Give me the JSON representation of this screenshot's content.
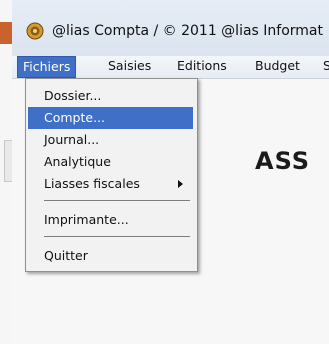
{
  "window": {
    "title": "@lias Compta  /  © 2011 @lias Informat",
    "icon": "app-icon"
  },
  "menubar": {
    "items": [
      "Fichiers",
      "Saisies",
      "Editions",
      "Budget",
      "S"
    ],
    "active": "Fichiers"
  },
  "dropdown": {
    "items": [
      {
        "label": "Dossier..."
      },
      {
        "label": "Compte...",
        "highlighted": true
      },
      {
        "label": "Journal..."
      },
      {
        "label": "Analytique"
      },
      {
        "label": "Liasses fiscales",
        "submenu": true
      },
      {
        "label": "Imprimante..."
      },
      {
        "label": "Quitter"
      }
    ]
  },
  "content": {
    "background_text": "ASS"
  },
  "colors": {
    "highlight": "#3f6fc6",
    "menu_bg": "#f2f2f2",
    "frame_accent": "#c9622c"
  }
}
